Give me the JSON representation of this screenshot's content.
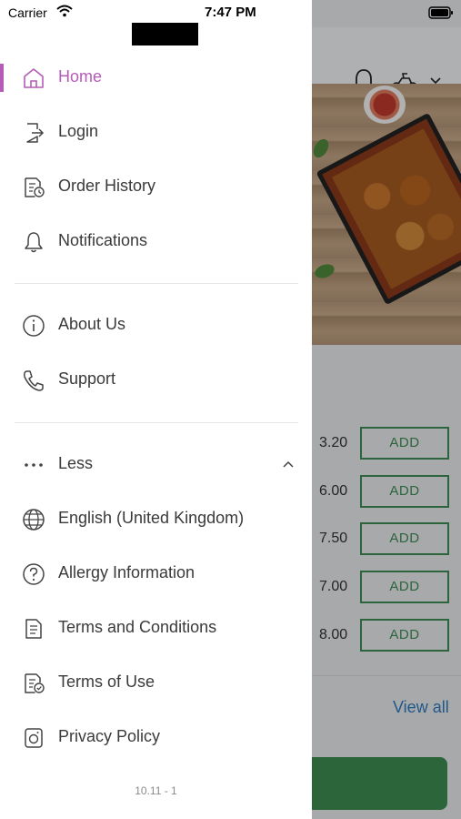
{
  "status_bar": {
    "carrier": "Carrier",
    "time": "7:47 PM"
  },
  "drawer": {
    "accent_color": "#b45cb7",
    "primary_items": [
      {
        "label": "Home",
        "icon": "home-icon",
        "active": true
      },
      {
        "label": "Login",
        "icon": "login-icon"
      },
      {
        "label": "Order History",
        "icon": "order-history-icon"
      },
      {
        "label": "Notifications",
        "icon": "bell-icon"
      }
    ],
    "secondary_items": [
      {
        "label": "About Us",
        "icon": "info-icon"
      },
      {
        "label": "Support",
        "icon": "phone-icon"
      }
    ],
    "less": {
      "label": "Less",
      "icon": "more-dots-icon",
      "expanded": true
    },
    "more_items": [
      {
        "label": "English (United Kingdom)",
        "icon": "globe-icon"
      },
      {
        "label": "Allergy Information",
        "icon": "question-circle-icon"
      },
      {
        "label": "Terms and Conditions",
        "icon": "document-icon"
      },
      {
        "label": "Terms of Use",
        "icon": "document-check-icon"
      },
      {
        "label": "Privacy Policy",
        "icon": "privacy-icon"
      }
    ],
    "version": "10.11 - 1"
  },
  "background": {
    "add_label": "ADD",
    "prices": [
      "3.20",
      "6.00",
      "7.50",
      "7.00",
      "8.00"
    ],
    "view_all": "View all",
    "brand_green": "#3f8d52"
  }
}
